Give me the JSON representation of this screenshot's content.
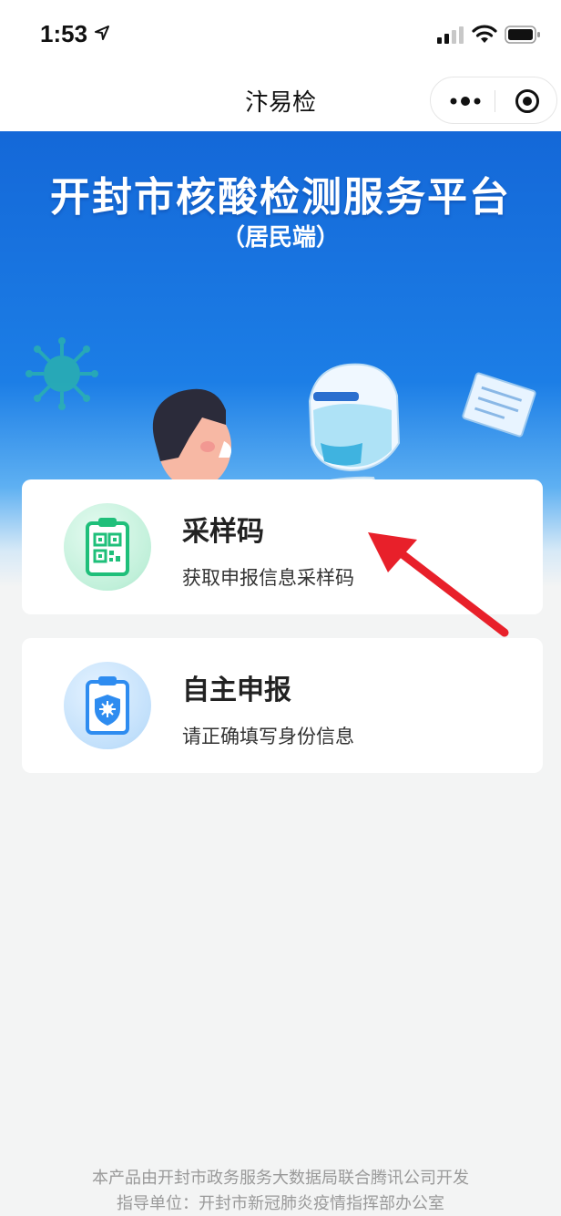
{
  "status_bar": {
    "time": "1:53"
  },
  "nav": {
    "title": "汴易检",
    "more_icon": "more-dots-icon",
    "close_icon": "target-circle-icon"
  },
  "banner": {
    "title": "开封市核酸检测服务平台",
    "subtitle": "（居民端）"
  },
  "cards": [
    {
      "title": "采样码",
      "desc": "获取申报信息采样码",
      "icon": "qr-clipboard-icon",
      "accent": "#1fbf7a"
    },
    {
      "title": "自主申报",
      "desc": "请正确填写身份信息",
      "icon": "shield-clipboard-icon",
      "accent": "#2e8cf0"
    }
  ],
  "footer": {
    "line1": "本产品由开封市政务服务大数据局联合腾讯公司开发",
    "line2": "指导单位：开封市新冠肺炎疫情指挥部办公室"
  },
  "colors": {
    "banner_blue": "#1468d8",
    "arrow_red": "#e8202a",
    "background": "#f3f4f4"
  }
}
